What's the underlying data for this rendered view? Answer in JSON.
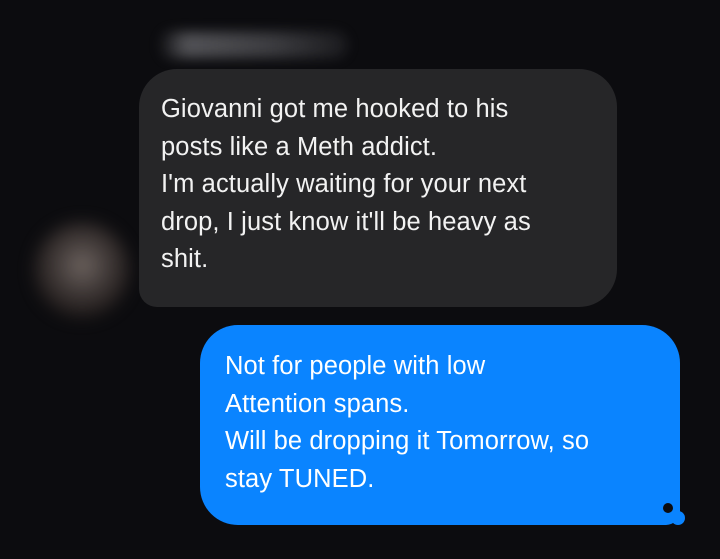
{
  "conversation": {
    "incoming": {
      "lines": [
        "Giovanni got me hooked to his",
        "posts like a Meth addict.",
        "I'm actually waiting for your next",
        "drop, I just know it'll be heavy as",
        "shit."
      ]
    },
    "outgoing": {
      "lines": [
        "Not for people with low",
        "Attention spans.",
        "Will be dropping it Tomorrow, so",
        "stay TUNED."
      ]
    }
  },
  "colors": {
    "background": "#0c0c0f",
    "incoming_bubble": "#262628",
    "outgoing_bubble": "#0a84ff",
    "text": "#ffffff"
  }
}
